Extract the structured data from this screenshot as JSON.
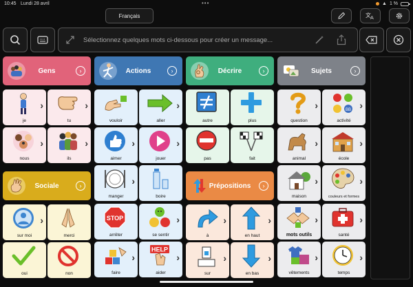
{
  "status": {
    "time": "10:45",
    "date": "Lundi 28 avril",
    "battery": "1 %",
    "dots": "•••"
  },
  "language": "Français",
  "message": {
    "placeholder": "Sélectionnez quelques mots ci-dessous pour créer un message..."
  },
  "colors": {
    "gens": "#e1637a",
    "actions": "#3f77b3",
    "decrire": "#3fae7e",
    "sujets": "#7e8289",
    "sociale": "#d9ac1c",
    "prepositions": "#ea8a45",
    "gens_tile": "#fbe9ec",
    "actions_tile": "#e3f0fb",
    "decrire_tile": "#e6f6ea",
    "sujets_tile": "#ececee",
    "sociale_tile": "#fbf5d6",
    "prepositions_tile": "#fbe8dc"
  },
  "categories": {
    "gens": "Gens",
    "actions": "Actions",
    "decrire": "Décrire",
    "sujets": "Sujets",
    "sociale": "Sociale",
    "prepositions": "Prépositions"
  },
  "gens": [
    "je",
    "tu",
    "nous",
    "ils"
  ],
  "sociale": [
    "sur moi",
    "merci",
    "oui",
    "non"
  ],
  "actions": [
    "vouloir",
    "aller",
    "aimer",
    "jouer",
    "manger",
    "boire",
    "arrêter",
    "se sentir",
    "faire",
    "aider"
  ],
  "decrire": [
    "autre",
    "plus",
    "pas",
    "fait"
  ],
  "prepositions": [
    "à",
    "en haut",
    "sur",
    "en bas"
  ],
  "sujets": [
    "question",
    "activité",
    "animal",
    "école",
    "maison",
    "couleurs et formes",
    "mots outils",
    "santé",
    "vêtements",
    "temps"
  ],
  "icons": {
    "top": [
      "pencil-icon",
      "translate-icon",
      "gear-icon"
    ],
    "row": [
      "search-icon",
      "keyboard-icon",
      "expand-icon",
      "magic-wand-icon",
      "share-icon",
      "backspace-icon",
      "clear-icon"
    ]
  }
}
